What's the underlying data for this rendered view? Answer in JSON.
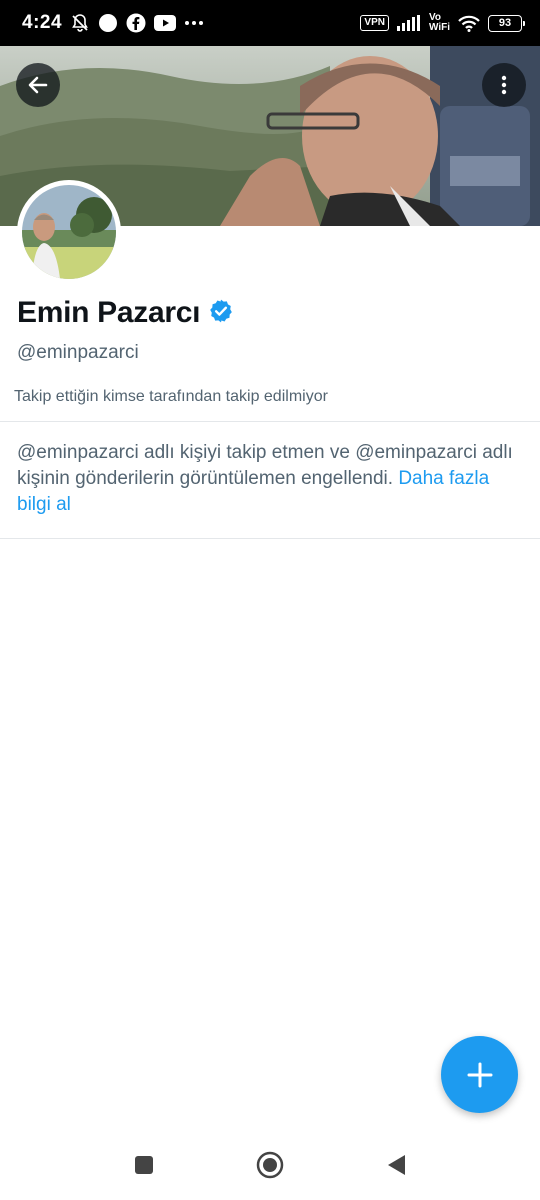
{
  "status_bar": {
    "time": "4:24",
    "icons": [
      "mute-notifications-icon",
      "circle-notification-icon",
      "facebook-icon",
      "youtube-icon",
      "more-notifications-icon"
    ],
    "vpn_label": "VPN",
    "vowifi_top": "Vo",
    "vowifi_bottom": "WiFi",
    "battery_level": "93"
  },
  "header": {
    "back_icon": "arrow-left-icon",
    "more_icon": "more-vertical-icon"
  },
  "profile": {
    "display_name": "Emin Pazarcı",
    "verified_icon": "verified-badge-icon",
    "verified_color": "#1d9bf0",
    "handle": "@eminpazarci",
    "followers_note": "Takip ettiğin kimse tarafından takip edilmiyor"
  },
  "blocked_notice": {
    "text": "@eminpazarci adlı kişiyi takip etmen ve @eminpazarci adlı kişinin gönderilerin görüntülemen engellendi.",
    "link_text": "Daha fazla bilgi al"
  },
  "fab": {
    "icon": "plus-icon",
    "color": "#1d9bf0"
  },
  "nav_bar": {
    "recents_icon": "square-recents-icon",
    "home_icon": "circle-home-icon",
    "back_icon": "triangle-back-icon"
  }
}
